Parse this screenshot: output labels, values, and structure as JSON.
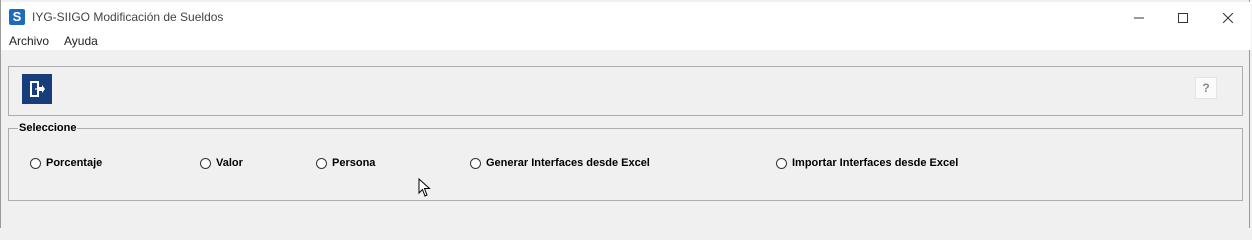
{
  "window": {
    "title": "IYG-SIIGO Modificación de Sueldos",
    "app_icon_letter": "S",
    "minimize": "—",
    "maximize": "☐",
    "close": "✕"
  },
  "menu": [
    {
      "label": "Archivo"
    },
    {
      "label": "Ayuda"
    }
  ],
  "toolbar": {
    "help_label": "?"
  },
  "selection_group": {
    "legend": "Seleccione",
    "options": [
      {
        "label": "Porcentaje",
        "selected": false
      },
      {
        "label": "Valor",
        "selected": false
      },
      {
        "label": "Persona",
        "selected": false
      },
      {
        "label": "Generar Interfaces desde Excel",
        "selected": false
      },
      {
        "label": "Importar Interfaces desde Excel",
        "selected": false
      }
    ]
  },
  "colors": {
    "exit_button": "#173e7a",
    "app_icon": "#1e6bb8",
    "background": "#f0f0f0"
  },
  "icons": {
    "exit": "door-exit-icon",
    "cursor": "mouse-pointer-icon"
  }
}
